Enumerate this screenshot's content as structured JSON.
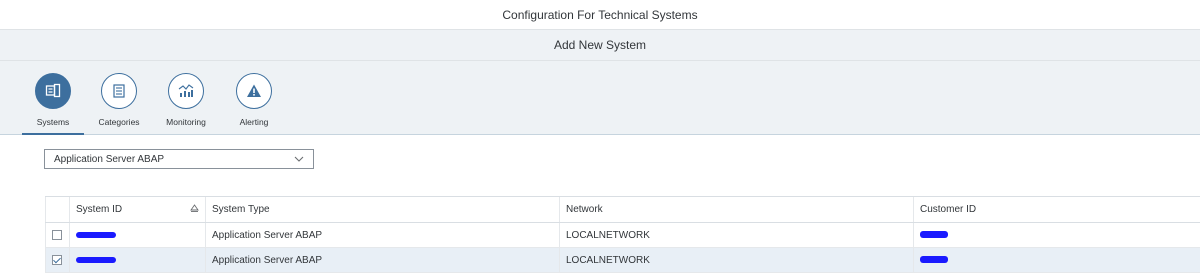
{
  "app": {
    "title": "Configuration For Technical Systems"
  },
  "subheader": {
    "title": "Add New System"
  },
  "tabs": [
    {
      "label": "Systems",
      "icon": "systems-icon",
      "selected": true
    },
    {
      "label": "Categories",
      "icon": "list-icon",
      "selected": false
    },
    {
      "label": "Monitoring",
      "icon": "monitoring-icon",
      "selected": false
    },
    {
      "label": "Alerting",
      "icon": "alert-icon",
      "selected": false
    }
  ],
  "system_type_select": {
    "value": "Application Server ABAP"
  },
  "table": {
    "columns": [
      "System ID",
      "System Type",
      "Network",
      "Customer ID"
    ],
    "rows": [
      {
        "checked": false,
        "system_type": "Application Server ABAP",
        "network": "LOCALNETWORK"
      },
      {
        "checked": true,
        "system_type": "Application Server ABAP",
        "network": "LOCALNETWORK"
      }
    ]
  },
  "colors": {
    "accent": "#3d6f9e",
    "header_bg": "#eef2f5",
    "selected_row_bg": "#e8eff6",
    "redaction": "#1a1aff"
  }
}
